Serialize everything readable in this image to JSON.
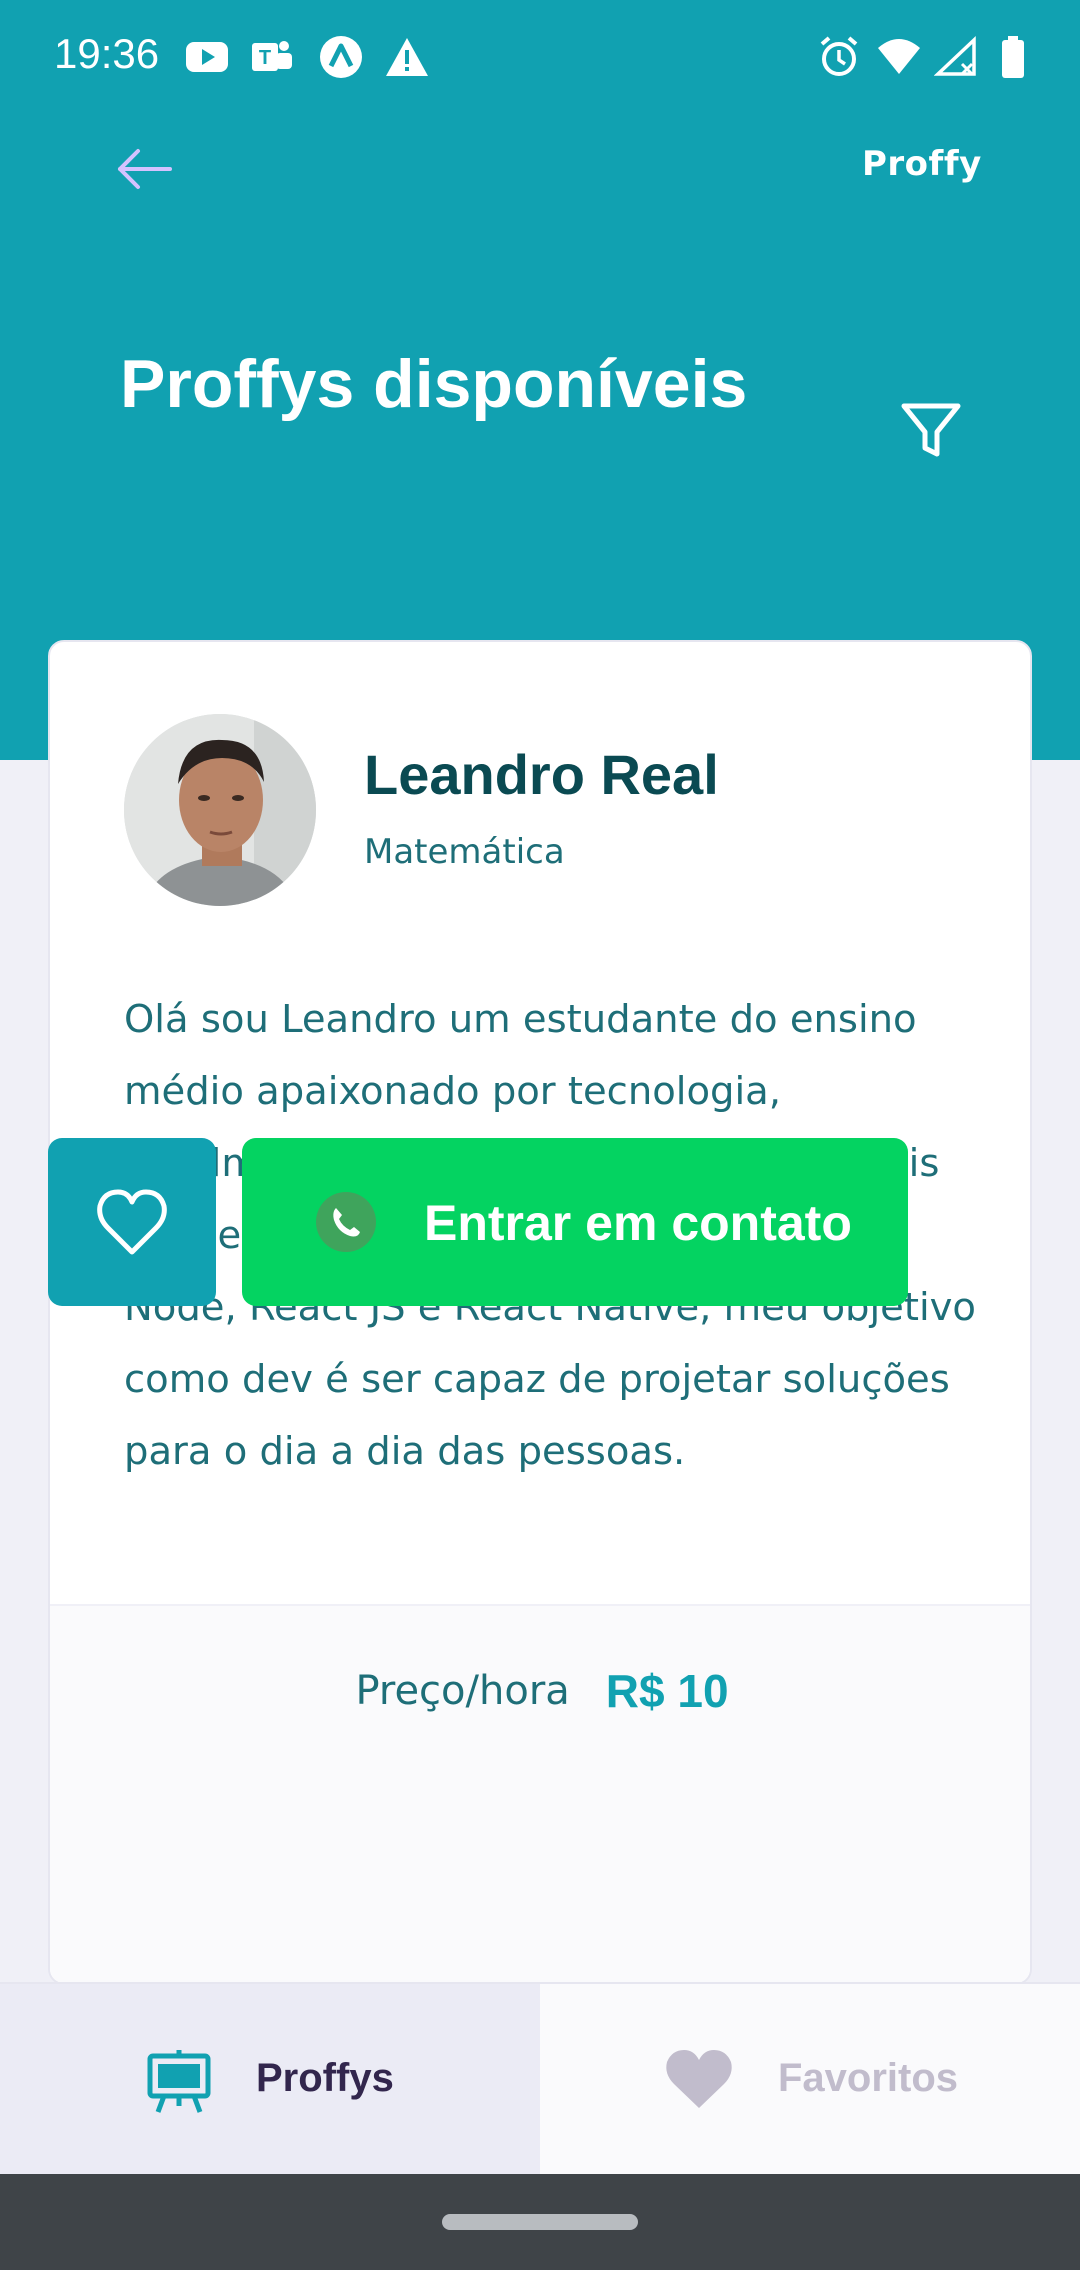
{
  "status_bar": {
    "time": "19:36",
    "left_icons": [
      "youtube-icon",
      "teams-icon",
      "app-a-icon",
      "warning-icon"
    ],
    "right_icons": [
      "alarm-icon",
      "wifi-icon",
      "signal-icon",
      "battery-icon"
    ]
  },
  "header": {
    "brand": "Proffy",
    "title": "Proffys disponíveis",
    "colors": {
      "primary": "#11A1B1",
      "text": "#FFFFFF"
    }
  },
  "teacher": {
    "name": "Leandro Real",
    "subject": "Matemática",
    "bio": "Olá sou Leandro um estudante do ensino médio apaixonado por tecnologia, atualmente estou estudando a Stack mais conhecida do JavaScript composta pelo Node, React JS e React Native, meu objetivo como dev é ser capaz de projetar soluções para o dia a dia das pessoas.",
    "price_label": "Preço/hora",
    "price_value": "R$ 10",
    "contact_label": "Entrar em contato",
    "colors": {
      "contact": "#04D361",
      "favorite": "#11A1B1"
    }
  },
  "tabs": [
    {
      "label": "Proffys",
      "icon": "easel-icon",
      "active": true
    },
    {
      "label": "Favoritos",
      "icon": "heart-icon",
      "active": false
    }
  ]
}
